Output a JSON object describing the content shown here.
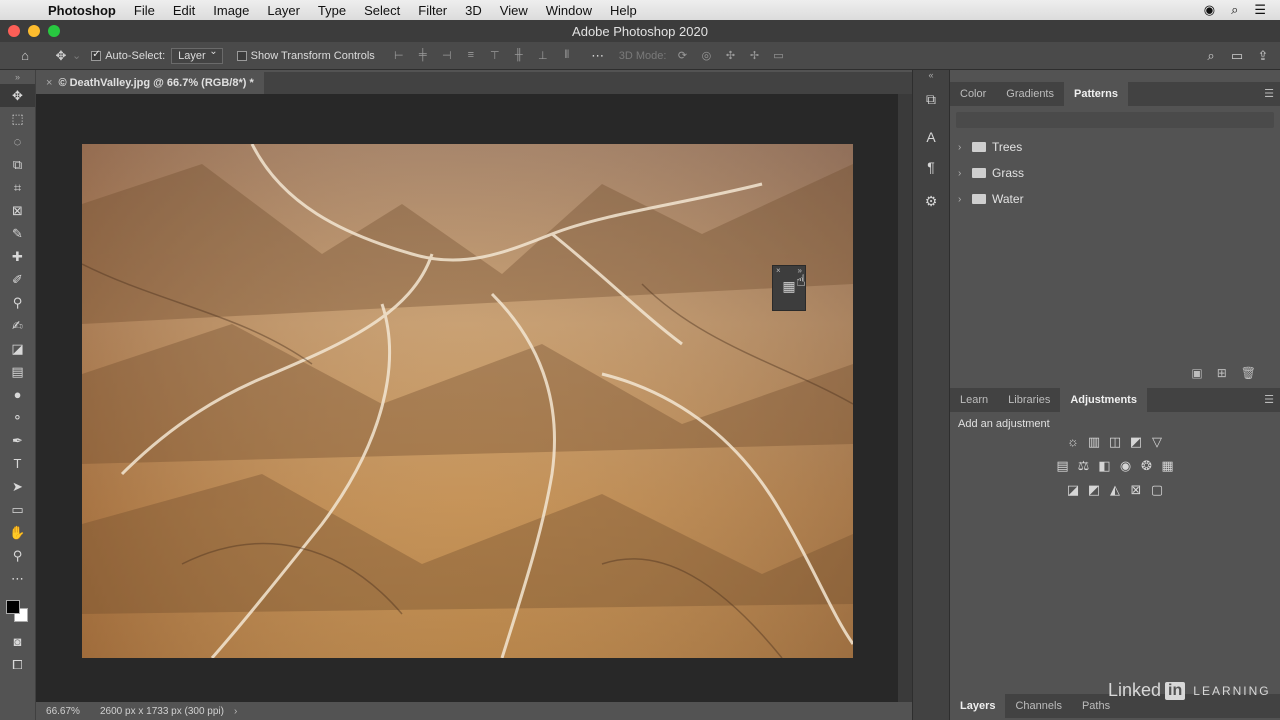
{
  "menubar": {
    "app_name": "Photoshop",
    "items": [
      "File",
      "Edit",
      "Image",
      "Layer",
      "Type",
      "Select",
      "Filter",
      "3D",
      "View",
      "Window",
      "Help"
    ]
  },
  "titlebar": {
    "title": "Adobe Photoshop 2020"
  },
  "options": {
    "auto_select_label": "Auto-Select:",
    "auto_select_value": "Layer",
    "transform_label": "Show Transform Controls",
    "mode_3d": "3D Mode:"
  },
  "document": {
    "tab_title": "© DeathValley.jpg @ 66.7% (RGB/8*) *"
  },
  "status": {
    "zoom": "66.67%",
    "info": "2600 px x 1733 px (300 ppi)"
  },
  "patterns_panel": {
    "tabs": [
      "Color",
      "Gradients",
      "Patterns"
    ],
    "active_tab": "Patterns",
    "folders": [
      "Trees",
      "Grass",
      "Water"
    ]
  },
  "adjust_panel": {
    "tabs": [
      "Learn",
      "Libraries",
      "Adjustments"
    ],
    "active_tab": "Adjustments",
    "label": "Add an adjustment"
  },
  "layers_panel": {
    "tabs": [
      "Layers",
      "Channels",
      "Paths"
    ],
    "active_tab": "Layers"
  },
  "watermark": {
    "brand": "Linked",
    "in": "in",
    "learning": "LEARNING"
  },
  "colors": {
    "accent_active": "#535353",
    "canvas_bg": "#282828"
  }
}
